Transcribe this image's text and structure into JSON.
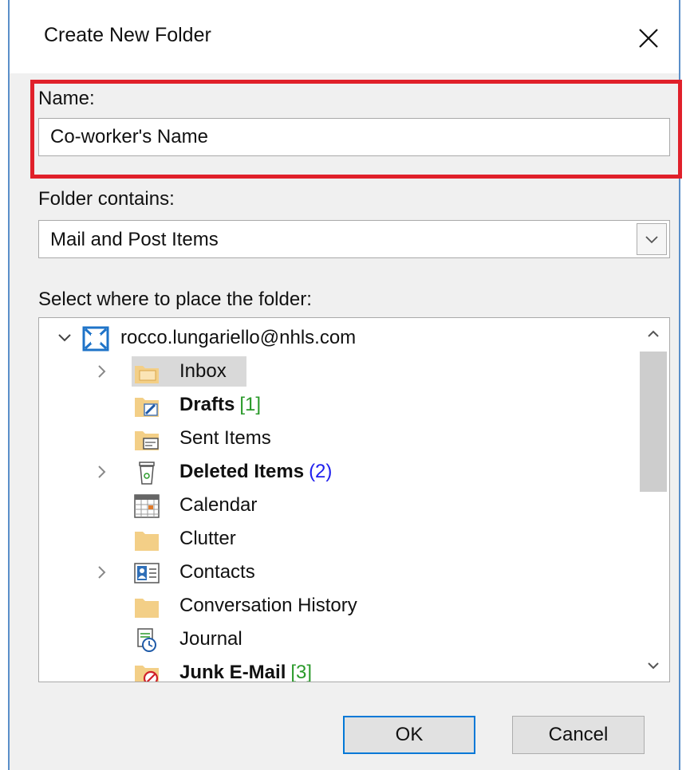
{
  "dialog": {
    "title": "Create New Folder",
    "close_label": "×"
  },
  "name_field": {
    "label": "Name:",
    "value": "Co-worker's Name"
  },
  "folder_contains": {
    "label": "Folder contains:",
    "selected": "Mail and Post Items"
  },
  "placement": {
    "label": "Select where to place the folder:"
  },
  "tree": {
    "account": "rocco.lungariello@nhls.com",
    "items": [
      {
        "label": "Inbox",
        "count": "",
        "bold": false,
        "expandable": true,
        "icon": "inbox-folder-icon"
      },
      {
        "label": "Drafts",
        "count": "[1]",
        "bold": true,
        "expandable": false,
        "icon": "drafts-folder-icon"
      },
      {
        "label": "Sent Items",
        "count": "",
        "bold": false,
        "expandable": false,
        "icon": "sent-items-folder-icon"
      },
      {
        "label": "Deleted Items",
        "count": "(2)",
        "bold": true,
        "expandable": true,
        "icon": "deleted-items-icon"
      },
      {
        "label": "Calendar",
        "count": "",
        "bold": false,
        "expandable": false,
        "icon": "calendar-icon"
      },
      {
        "label": "Clutter",
        "count": "",
        "bold": false,
        "expandable": false,
        "icon": "folder-icon"
      },
      {
        "label": "Contacts",
        "count": "",
        "bold": false,
        "expandable": true,
        "icon": "contacts-icon"
      },
      {
        "label": "Conversation History",
        "count": "",
        "bold": false,
        "expandable": false,
        "icon": "folder-icon"
      },
      {
        "label": "Journal",
        "count": "",
        "bold": false,
        "expandable": false,
        "icon": "journal-icon"
      },
      {
        "label": "Junk E-Mail",
        "count": "[3]",
        "bold": true,
        "expandable": false,
        "icon": "junk-email-folder-icon"
      }
    ]
  },
  "buttons": {
    "ok": "OK",
    "cancel": "Cancel"
  },
  "colors": {
    "highlight_border": "#e0202a",
    "green_count": "#2a9a2a",
    "blue_count": "#2020ee",
    "folder_yellow": "#f3cf87",
    "default_button_border": "#0078d7"
  }
}
